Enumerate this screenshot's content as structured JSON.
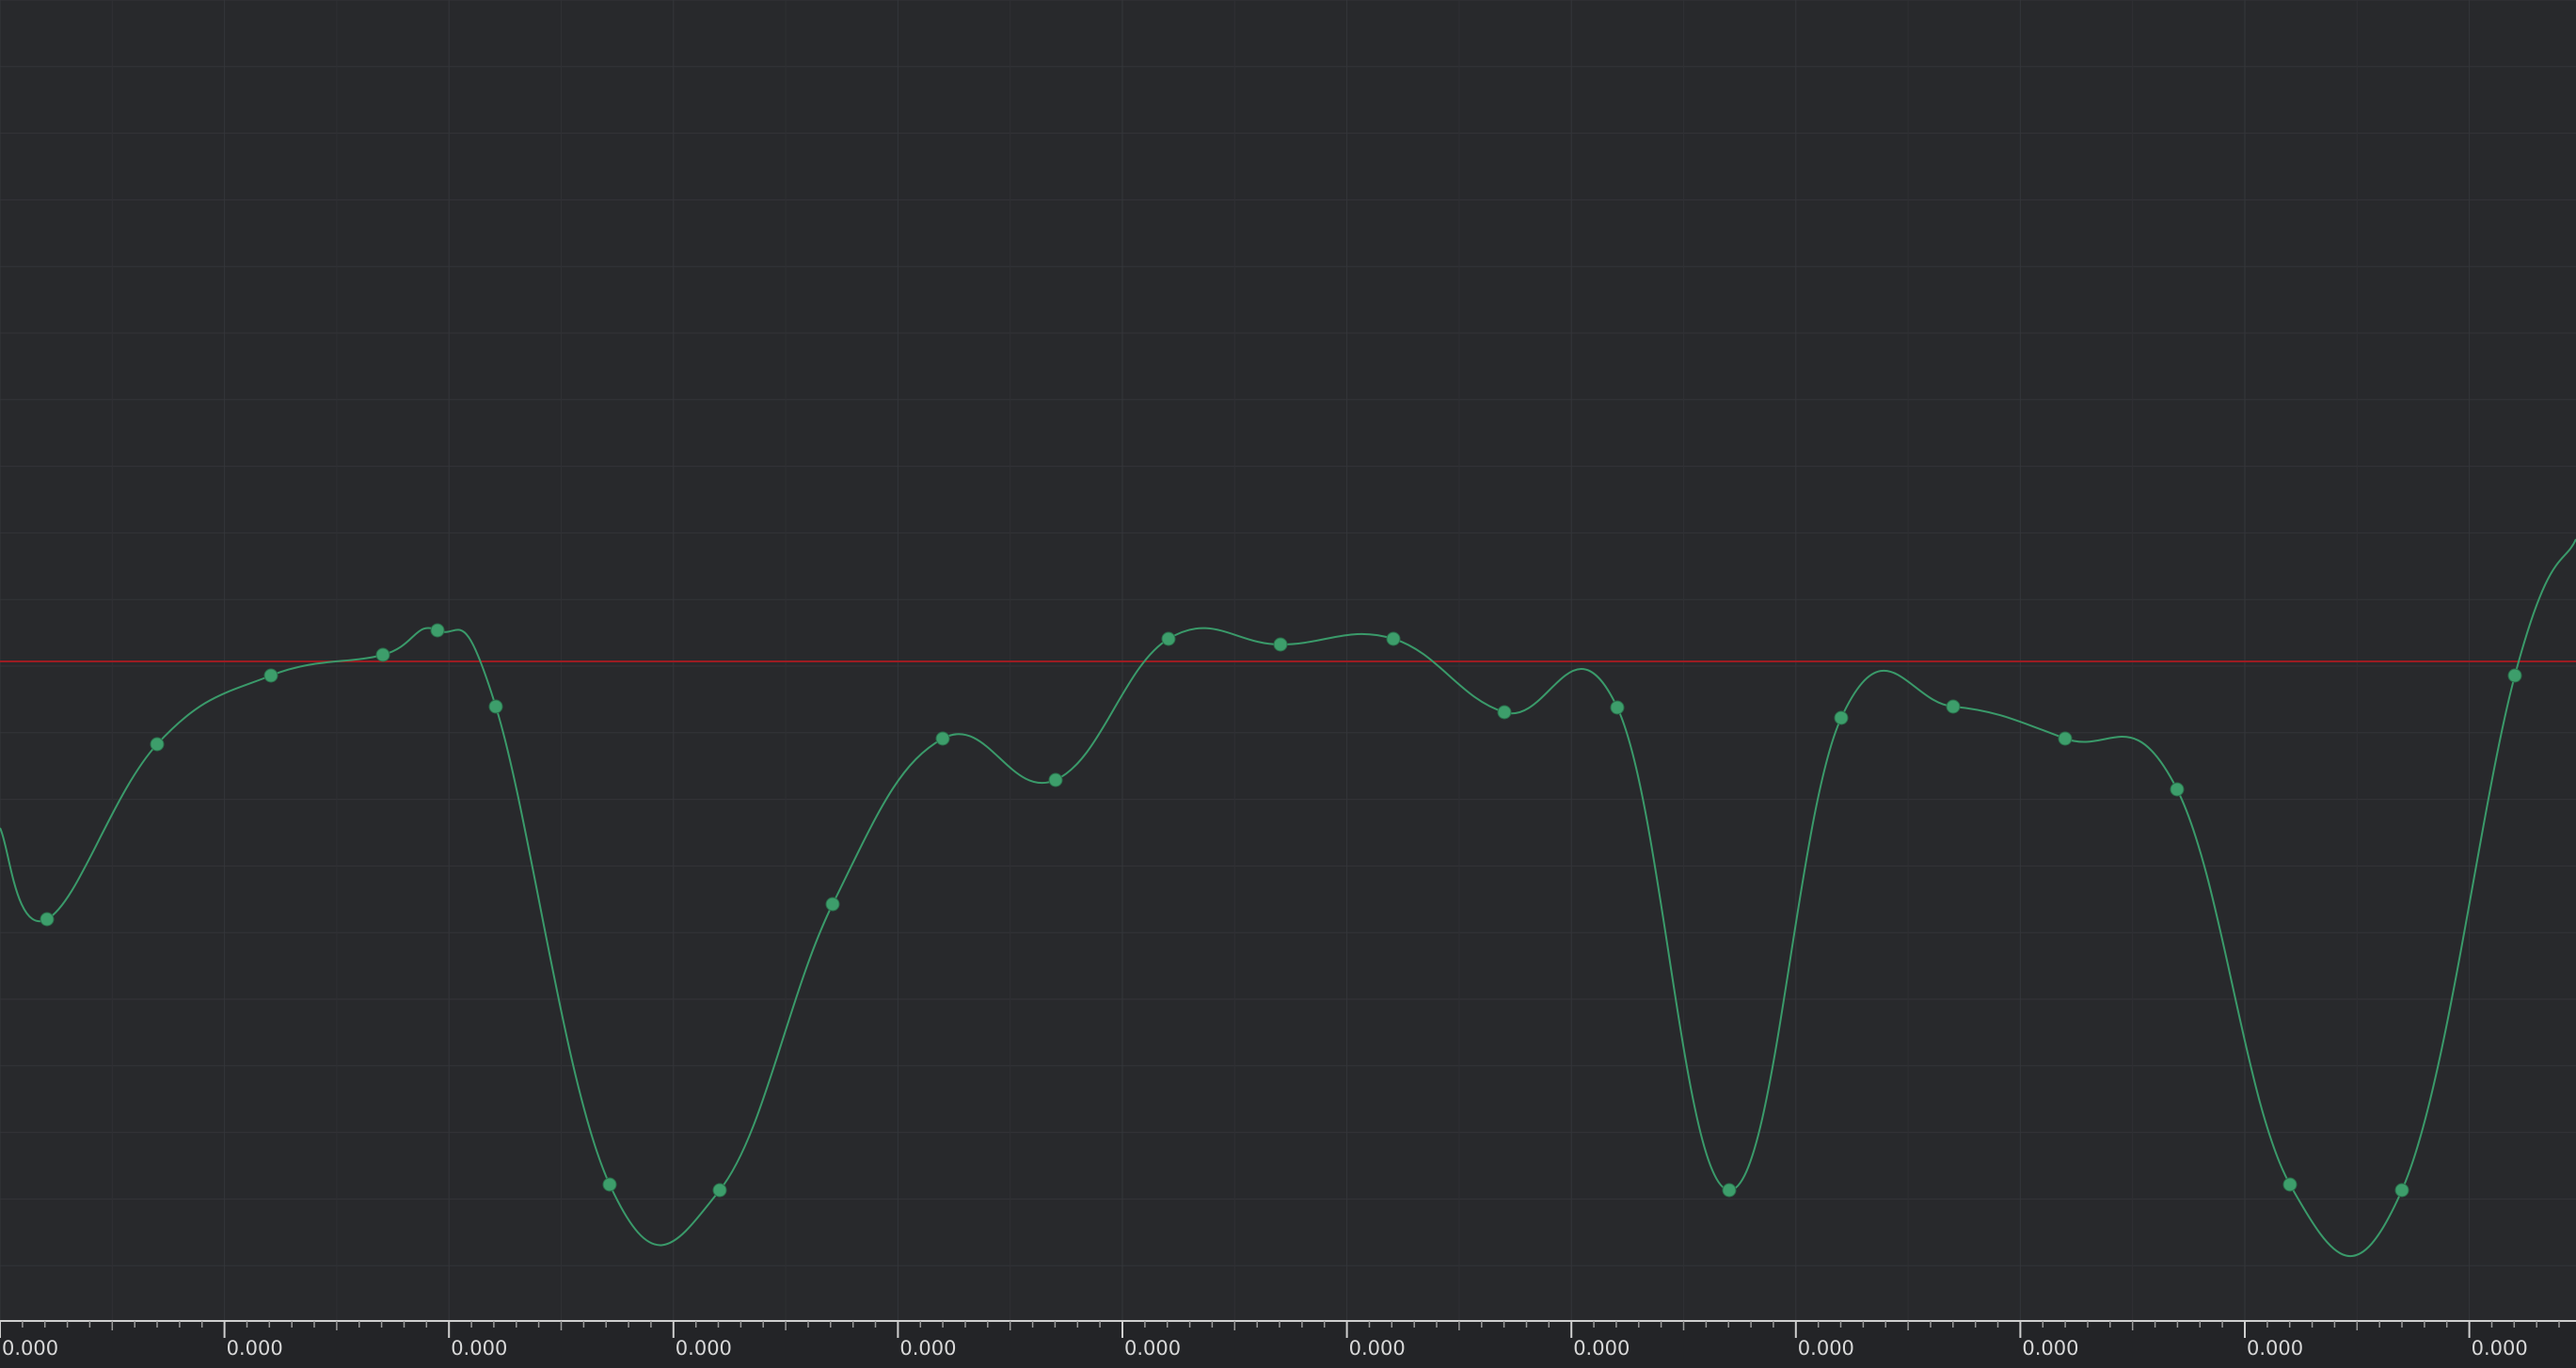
{
  "curve_color": "#3a9a6a",
  "keyframe_color": "#3d9e6b",
  "baseline_color": "#9c1c22",
  "background_color": "#28292c",
  "ruler": {
    "labels": [
      "0.000",
      "0.000",
      "0.000",
      "0.000",
      "0.000",
      "0.000",
      "0.000",
      "0.000",
      "0.000",
      "0.000",
      "0.000",
      "0.000"
    ]
  },
  "chart_data": {
    "type": "line",
    "baseline_value": 0,
    "ylim": [
      -1.2,
      1.2
    ],
    "grid": true,
    "keyframe_count": 23
  }
}
